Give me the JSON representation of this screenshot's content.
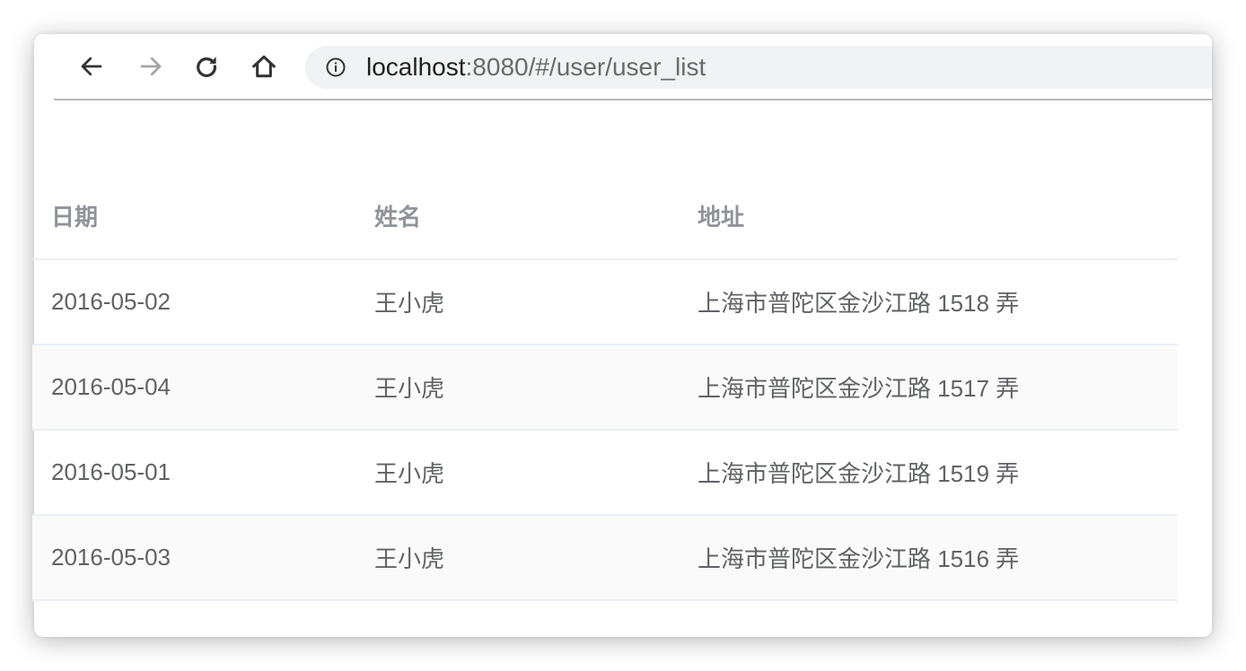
{
  "browser": {
    "url_host": "localhost",
    "url_rest": ":8080/#/user/user_list"
  },
  "table": {
    "headers": {
      "date": "日期",
      "name": "姓名",
      "address": "地址"
    },
    "rows": [
      {
        "date": "2016-05-02",
        "name": "王小虎",
        "address": "上海市普陀区金沙江路 1518 弄"
      },
      {
        "date": "2016-05-04",
        "name": "王小虎",
        "address": "上海市普陀区金沙江路 1517 弄"
      },
      {
        "date": "2016-05-01",
        "name": "王小虎",
        "address": "上海市普陀区金沙江路 1519 弄"
      },
      {
        "date": "2016-05-03",
        "name": "王小虎",
        "address": "上海市普陀区金沙江路 1516 弄"
      }
    ]
  },
  "icons": {
    "back": "arrow-left-icon",
    "forward": "arrow-right-icon",
    "reload": "reload-icon",
    "home": "home-icon",
    "site_info": "info-icon"
  },
  "colors": {
    "header_text": "#909399",
    "cell_text": "#606266",
    "row_divider": "#ebeef5",
    "striped_row": "#fafafa",
    "omnibox_bg": "#f0f2f3"
  }
}
